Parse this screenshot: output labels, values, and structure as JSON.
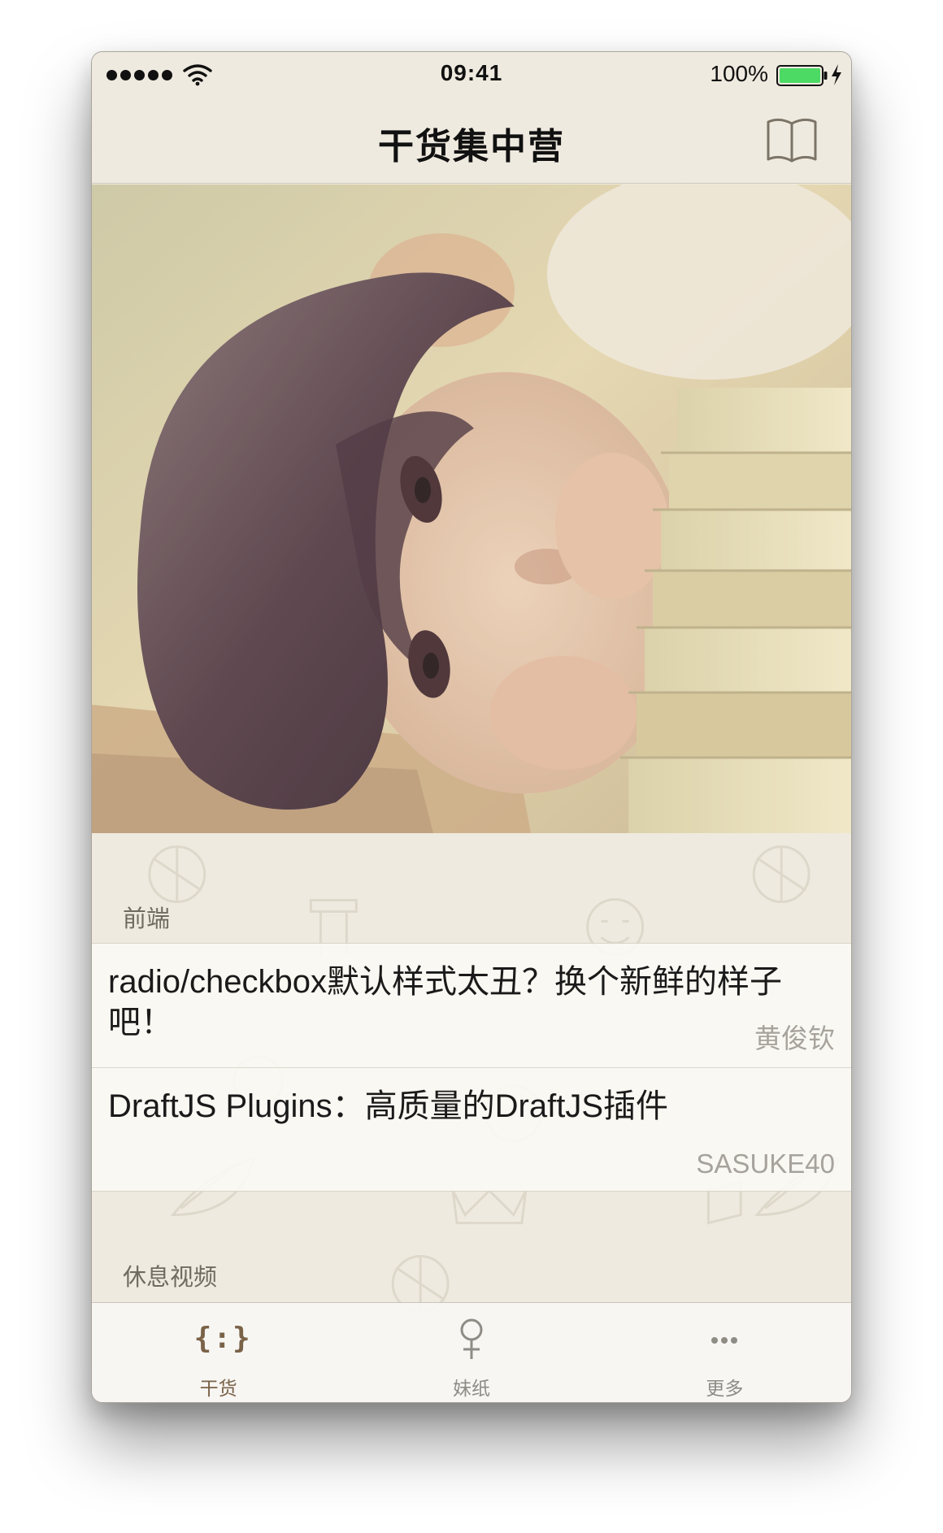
{
  "status_bar": {
    "time": "09:41",
    "battery_percent": "100%",
    "signal_bars": 5,
    "battery_color": "#4cd964"
  },
  "nav": {
    "title": "干货集中营",
    "right_icon": "book-icon"
  },
  "hero": {
    "image_icon": "photo-girl-with-books"
  },
  "sections": [
    {
      "header": "前端",
      "items": [
        {
          "title": "radio/checkbox默认样式太丑？换个新鲜的样子吧！",
          "author": "黄俊钦"
        },
        {
          "title": "DraftJS Plugins：高质量的DraftJS插件",
          "author": "SASUKE40"
        }
      ]
    },
    {
      "header": "休息视频",
      "items": []
    }
  ],
  "tab_bar": {
    "active_color": "#7a6248",
    "tabs": [
      {
        "label": "干货",
        "icon": "braces-icon",
        "glyph": "{:}",
        "active": true
      },
      {
        "label": "妹纸",
        "icon": "female-symbol-icon",
        "active": false
      },
      {
        "label": "更多",
        "icon": "more-dots-icon",
        "active": false
      }
    ]
  }
}
